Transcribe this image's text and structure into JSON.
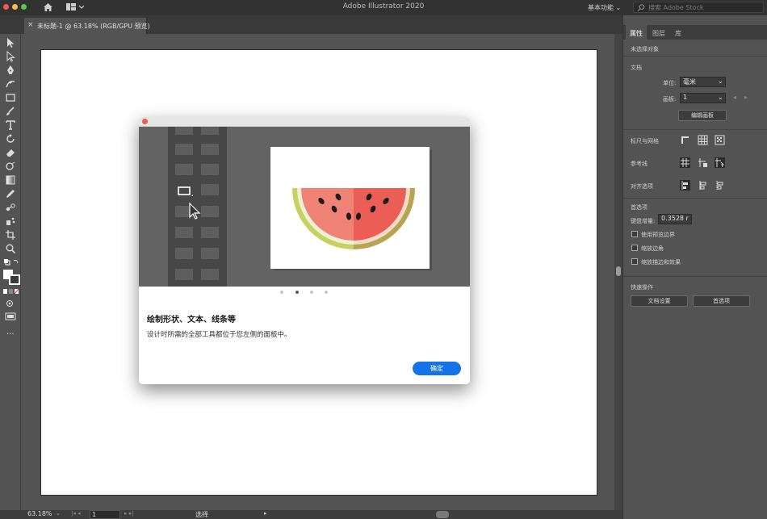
{
  "titlebar": {
    "app_title": "Adobe Illustrator 2020",
    "workspace_label": "基本功能",
    "search_placeholder": "搜索 Adobe Stock"
  },
  "document": {
    "tab_label": "未标题-1 @ 63.18% (RGB/GPU 预览)",
    "close_glyph": "×"
  },
  "status_bar": {
    "zoom": "63.18%",
    "artboard_number": "1",
    "status_text": "选择"
  },
  "panel": {
    "tabs": [
      "属性",
      "图层",
      "库"
    ],
    "no_selection": "未选择对象",
    "document_section": "文档",
    "units_label": "单位:",
    "units_value": "毫米",
    "artboard_label": "画板:",
    "artboard_value": "1",
    "edit_artboards_button": "编辑画板",
    "rulers_grids_label": "标尺与网格",
    "guides_label": "参考线",
    "align_options_label": "对齐选项",
    "preferences_label": "首选项",
    "keyboard_increment_label": "键盘增量:",
    "keyboard_increment_value": "0.3528 r",
    "checkboxes": [
      "使用预览边界",
      "缩放边角",
      "缩放描边和效果"
    ],
    "quick_actions_label": "快速操作",
    "doc_setup_button": "文档设置",
    "preferences_button": "首选项"
  },
  "dialog": {
    "heading": "绘制形状、文本、线条等",
    "body": "设计时所需的全部工具都位于您左侧的面板中。",
    "ok_button": "确定",
    "carousel_pages": 4,
    "carousel_active": 2
  },
  "colors": {
    "accent": "#1473e6",
    "close_red": "#f35b4f",
    "watermelon_flesh": "#ef6a5f",
    "watermelon_rind": "#c6d160"
  },
  "icons": [
    "home-icon",
    "layout-icon",
    "search-icon",
    "selection-tool-icon",
    "direct-selection-icon",
    "pen-icon",
    "curvature-icon",
    "rectangle-icon",
    "paintbrush-icon",
    "type-icon",
    "rotate-icon",
    "eraser-icon",
    "scale-icon",
    "gradient-icon",
    "eyedropper-icon",
    "blend-icon",
    "symbol-sprayer-icon",
    "artboard-tool-icon",
    "zoom-icon",
    "more-tools-icon"
  ]
}
